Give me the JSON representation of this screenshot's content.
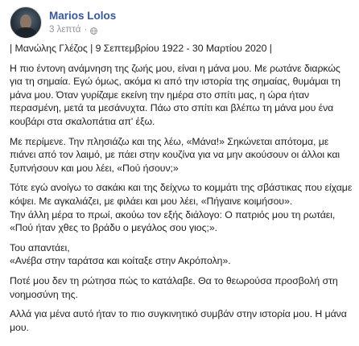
{
  "post": {
    "author": "Marios Lolos",
    "time": "3 λεπτά",
    "privacy_icon": "globe-icon",
    "paragraphs": [
      "| Μανώλης Γλέζος | 9 Σεπτεμβρίου 1922 - 30 Μαρτίου 2020 |",
      "Η πιο έντονη ανάμνηση της ζωής μου, είναι η μάνα μου. Με ρωτάνε διαρκώς για τη σημαία. Εγώ όμως, ακόμα κι από την ιστορία της σημαίας, θυμάμαι τη μάνα μου. Όταν γυρίζαμε εκείνη την ημέρα στο σπίτι μας, η ώρα ήταν περασμένη, μετά τα μεσάνυχτα. Πάω στο σπίτι και βλέπω τη μάνα μου ένα κουβάρι στα σκαλοπάτια απ' έξω.",
      "Με περίμενε. Την πλησιάζω και της λέω, «Μάνα!» Σηκώνεται απότομα, με πιάνει από τον λαιμό, με πάει στην κουζίνα για να μην ακούσουν οι άλλοι και ξυπνήσουν και μου λέει, «Πού ήσουν;»",
      "Τότε εγώ ανοίγω το σακάκι και της δείχνω το κομμάτι της σβάστικας που είχαμε κόψει. Με αγκαλιάζει, με φιλάει και μου λέει, «Πήγαινε κοιμήσου».",
      "Την άλλη μέρα το πρωί, ακούω τον εξής διάλογο: Ο πατριός μου τη ρωτάει, «Πού ήταν χθες το βράδυ ο μεγάλος σου γιος;».",
      "Του απαντάει,",
      "«Ανέβα στην ταράτσα και κοίταξε στην Ακρόπολη».",
      "Ποτέ μου δεν τη ρώτησα πώς το κατάλαβε. Θα το θεωρούσα προσβολή στη νοημοσύνη της.",
      "Αλλά για μένα αυτό ήταν το πιο συγκινητικό συμβάν στην ιστορία μου. Η μάνα μου."
    ]
  }
}
